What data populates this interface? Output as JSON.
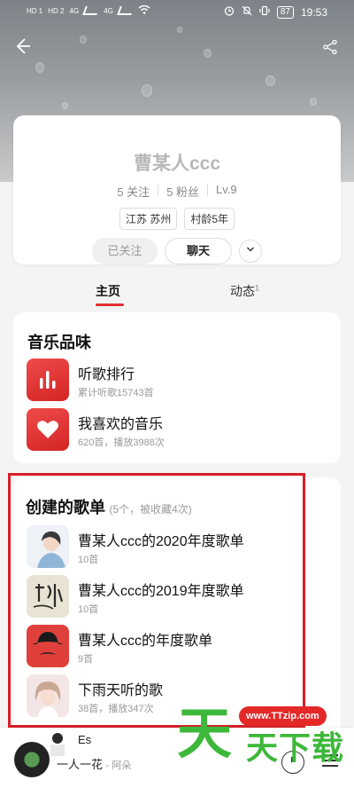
{
  "status_bar": {
    "left_label_1": "HD 1",
    "left_label_2": "HD 2",
    "signal_1": "4G",
    "signal_2": "4G",
    "battery": "87",
    "time": "19:53"
  },
  "profile": {
    "username": "曹某人ccc",
    "follows": "5 关注",
    "fans": "5 粉丝",
    "level": "Lv.9",
    "tags": [
      "江苏 苏州",
      "村龄5年"
    ],
    "followed_label": "已关注",
    "chat_label": "聊天"
  },
  "tabs": {
    "home": "主页",
    "dynamic": "动态",
    "dynamic_count": "1"
  },
  "music_taste": {
    "title": "音乐品味",
    "items": [
      {
        "title": "听歌排行",
        "subtitle": "累计听歌15743首"
      },
      {
        "title": "我喜欢的音乐",
        "subtitle": "620首，播放3988次"
      }
    ]
  },
  "playlists": {
    "title": "创建的歌单",
    "summary": "(5个，被收藏4次)",
    "items": [
      {
        "title": "曹某人ccc的2020年度歌单",
        "subtitle": "10首"
      },
      {
        "title": "曹某人ccc的2019年度歌单",
        "subtitle": "10首"
      },
      {
        "title": "曹某人ccc的年度歌单",
        "subtitle": "9首"
      },
      {
        "title": "下雨天听的歌",
        "subtitle": "38首，播放347次"
      }
    ],
    "next_peek": "Es"
  },
  "mini_player": {
    "title": "一人一花",
    "artist": "- 阿朵"
  },
  "watermark": {
    "url": "www.TTzip.com",
    "big": "天",
    "small": "天下载"
  },
  "colors": {
    "accent": "#e33030",
    "highlight": "#d61f27",
    "watermark_green": "#3db83a"
  }
}
